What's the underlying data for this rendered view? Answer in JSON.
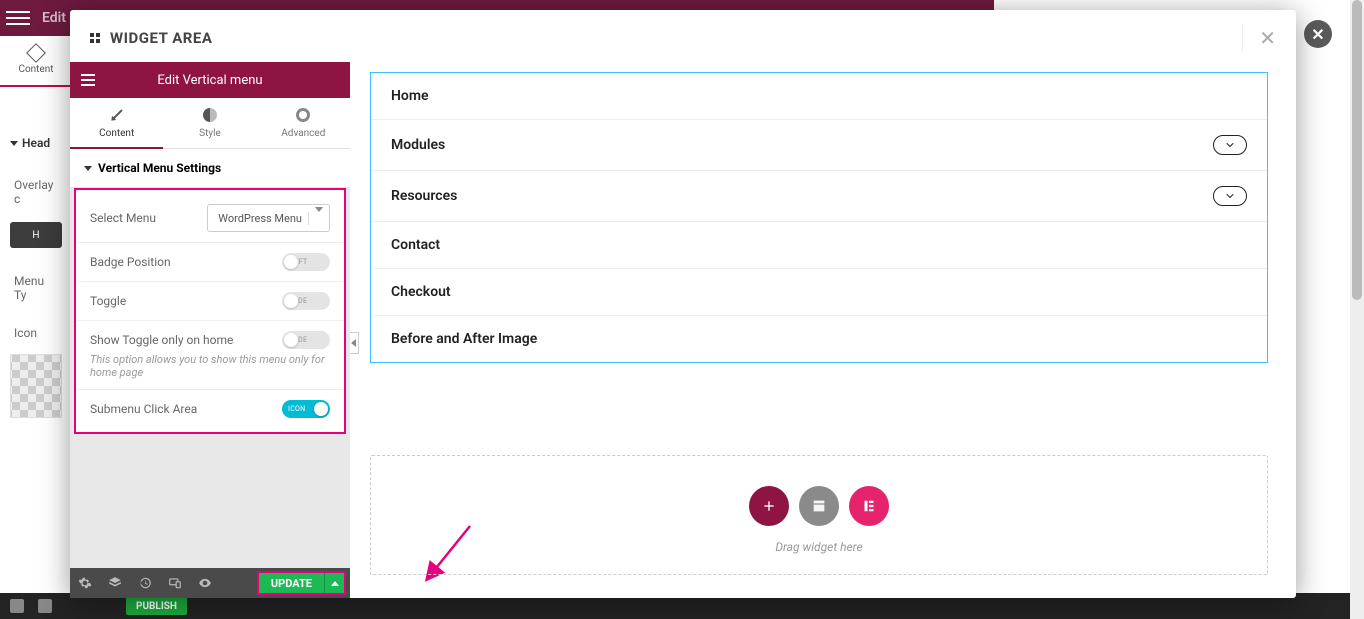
{
  "bg": {
    "topbar_title": "Edit Header Offcanvas",
    "contentTab": "Content",
    "headerSection": "Head",
    "overlayLabel": "Overlay c",
    "hcBtn": "H",
    "menuType": "Menu Ty",
    "iconLabel": "Icon",
    "publish": "PUBLISH"
  },
  "modal": {
    "title": "WIDGET AREA",
    "editTitle": "Edit Vertical menu",
    "tabs": {
      "content": "Content",
      "style": "Style",
      "advanced": "Advanced"
    },
    "sectionTitle": "Vertical Menu Settings",
    "settings": {
      "selectMenuLabel": "Select Menu",
      "selectMenuValue": "WordPress Menu",
      "badgePositionLabel": "Badge Position",
      "badgePositionToggle": "LEFT",
      "toggleLabel": "Toggle",
      "toggleVal": "HIDE",
      "showToggleHomeLabel": "Show Toggle only on home",
      "showToggleHomeVal": "HIDE",
      "helpText": "This option allows you to show this menu only for home page",
      "submenuClickLabel": "Submenu Click Area",
      "submenuClickVal": "ICON"
    },
    "update": "UPDATE",
    "menuItems": [
      {
        "label": "Home",
        "hasChildren": false
      },
      {
        "label": "Modules",
        "hasChildren": true
      },
      {
        "label": "Resources",
        "hasChildren": true
      },
      {
        "label": "Contact",
        "hasChildren": false
      },
      {
        "label": "Checkout",
        "hasChildren": false
      },
      {
        "label": "Before and After Image",
        "hasChildren": false
      }
    ],
    "dragHint": "Drag widget here"
  }
}
